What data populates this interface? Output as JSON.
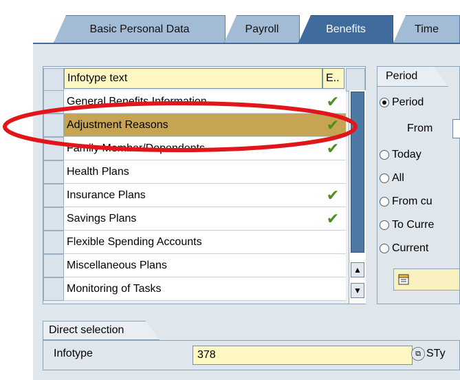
{
  "tabs": [
    {
      "label": "Basic Personal Data",
      "active": false
    },
    {
      "label": "Payroll",
      "active": false
    },
    {
      "label": "Benefits",
      "active": true
    },
    {
      "label": "Time",
      "active": false
    }
  ],
  "infotype_table": {
    "header_text": "Infotype text",
    "header_e": "E..",
    "rows": [
      {
        "label": "General Benefits Information",
        "check": true,
        "highlight": false
      },
      {
        "label": "Adjustment Reasons",
        "check": true,
        "highlight": true
      },
      {
        "label": "Family Member/Dependents",
        "check": true,
        "highlight": false
      },
      {
        "label": "Health Plans",
        "check": false,
        "highlight": false
      },
      {
        "label": "Insurance Plans",
        "check": true,
        "highlight": false
      },
      {
        "label": "Savings Plans",
        "check": true,
        "highlight": false
      },
      {
        "label": "Flexible Spending Accounts",
        "check": false,
        "highlight": false
      },
      {
        "label": "Miscellaneous Plans",
        "check": false,
        "highlight": false
      },
      {
        "label": "Monitoring of Tasks",
        "check": false,
        "highlight": false
      }
    ]
  },
  "period": {
    "title": "Period",
    "options": [
      {
        "label": "Period",
        "selected": true
      },
      {
        "label": "Today",
        "selected": false
      },
      {
        "label": "All",
        "selected": false
      },
      {
        "label": "From cu",
        "selected": false
      },
      {
        "label": "To Curre",
        "selected": false
      },
      {
        "label": "Current",
        "selected": false
      }
    ],
    "from_label": "From"
  },
  "direct_selection": {
    "title": "Direct selection",
    "infotype_label": "Infotype",
    "infotype_value": "378",
    "sty_label": "STy"
  },
  "colors": {
    "active_tab": "#3f6c9c",
    "highlight_row": "#c7a354",
    "check": "#4a8f1f",
    "annotation": "#e0161b"
  }
}
